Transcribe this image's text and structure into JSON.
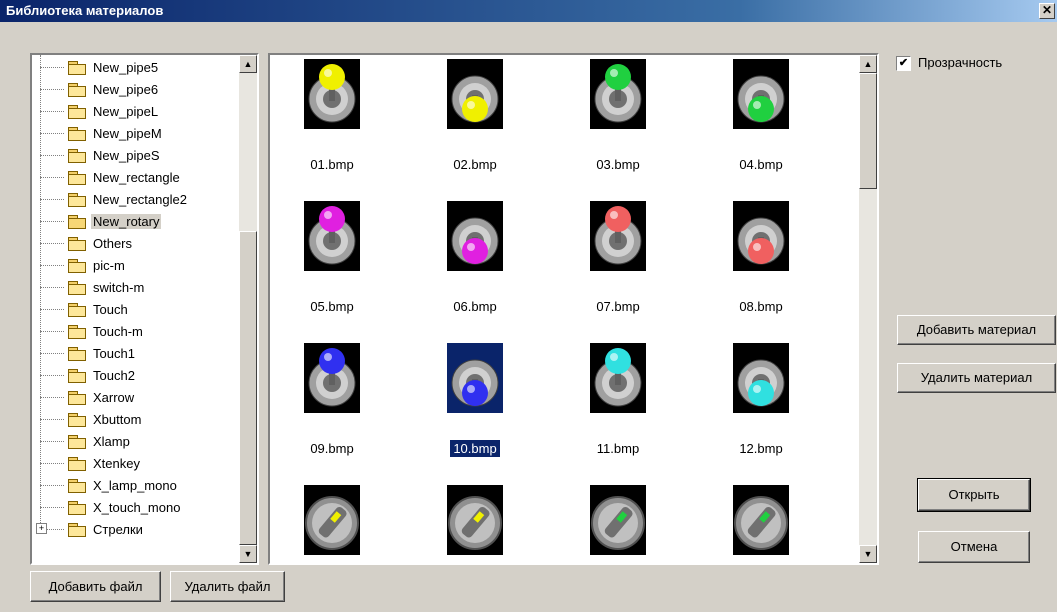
{
  "window": {
    "title": "Библиотека материалов",
    "close_glyph": "✕"
  },
  "tree": {
    "items": [
      {
        "label": "New_pipe5"
      },
      {
        "label": "New_pipe6"
      },
      {
        "label": "New_pipeL"
      },
      {
        "label": "New_pipeM"
      },
      {
        "label": "New_pipeS"
      },
      {
        "label": "New_rectangle"
      },
      {
        "label": "New_rectangle2"
      },
      {
        "label": "New_rotary",
        "selected": true
      },
      {
        "label": "Others"
      },
      {
        "label": "pic-m"
      },
      {
        "label": "switch-m"
      },
      {
        "label": "Touch"
      },
      {
        "label": "Touch-m"
      },
      {
        "label": "Touch1"
      },
      {
        "label": "Touch2"
      },
      {
        "label": "Xarrow"
      },
      {
        "label": "Xbuttom"
      },
      {
        "label": "Xlamp"
      },
      {
        "label": "Xtenkey"
      },
      {
        "label": "X_lamp_mono"
      },
      {
        "label": "X_touch_mono"
      },
      {
        "label": "Стрелки",
        "expandable": true
      }
    ],
    "expand_glyph": "+"
  },
  "files": {
    "items": [
      {
        "name": "01.bmp",
        "color": "#f0f000",
        "pos": "up"
      },
      {
        "name": "02.bmp",
        "color": "#f0f000",
        "pos": "down"
      },
      {
        "name": "03.bmp",
        "color": "#20d040",
        "pos": "up"
      },
      {
        "name": "04.bmp",
        "color": "#20d040",
        "pos": "down"
      },
      {
        "name": "05.bmp",
        "color": "#e020e0",
        "pos": "up"
      },
      {
        "name": "06.bmp",
        "color": "#e020e0",
        "pos": "down"
      },
      {
        "name": "07.bmp",
        "color": "#f06060",
        "pos": "up"
      },
      {
        "name": "08.bmp",
        "color": "#f06060",
        "pos": "down"
      },
      {
        "name": "09.bmp",
        "color": "#3030f0",
        "pos": "up"
      },
      {
        "name": "10.bmp",
        "color": "#3030f0",
        "pos": "down",
        "selected": true
      },
      {
        "name": "11.bmp",
        "color": "#30e0e0",
        "pos": "up"
      },
      {
        "name": "12.bmp",
        "color": "#30e0e0",
        "pos": "down"
      },
      {
        "name": "",
        "color": "#f0f000",
        "pos": "rotary"
      },
      {
        "name": "",
        "color": "#f0f000",
        "pos": "rotary"
      },
      {
        "name": "",
        "color": "#20d040",
        "pos": "rotary"
      },
      {
        "name": "",
        "color": "#20d040",
        "pos": "rotary"
      }
    ]
  },
  "options": {
    "transparency_label": "Прозрачность",
    "transparency_checked": true,
    "check_glyph": "✔"
  },
  "buttons": {
    "add_material": "Добавить материал",
    "delete_material": "Удалить материал",
    "open": "Открыть",
    "cancel": "Отмена",
    "add_file": "Добавить файл",
    "delete_file": "Удалить файл"
  },
  "scroll": {
    "up": "▲",
    "down": "▼"
  }
}
